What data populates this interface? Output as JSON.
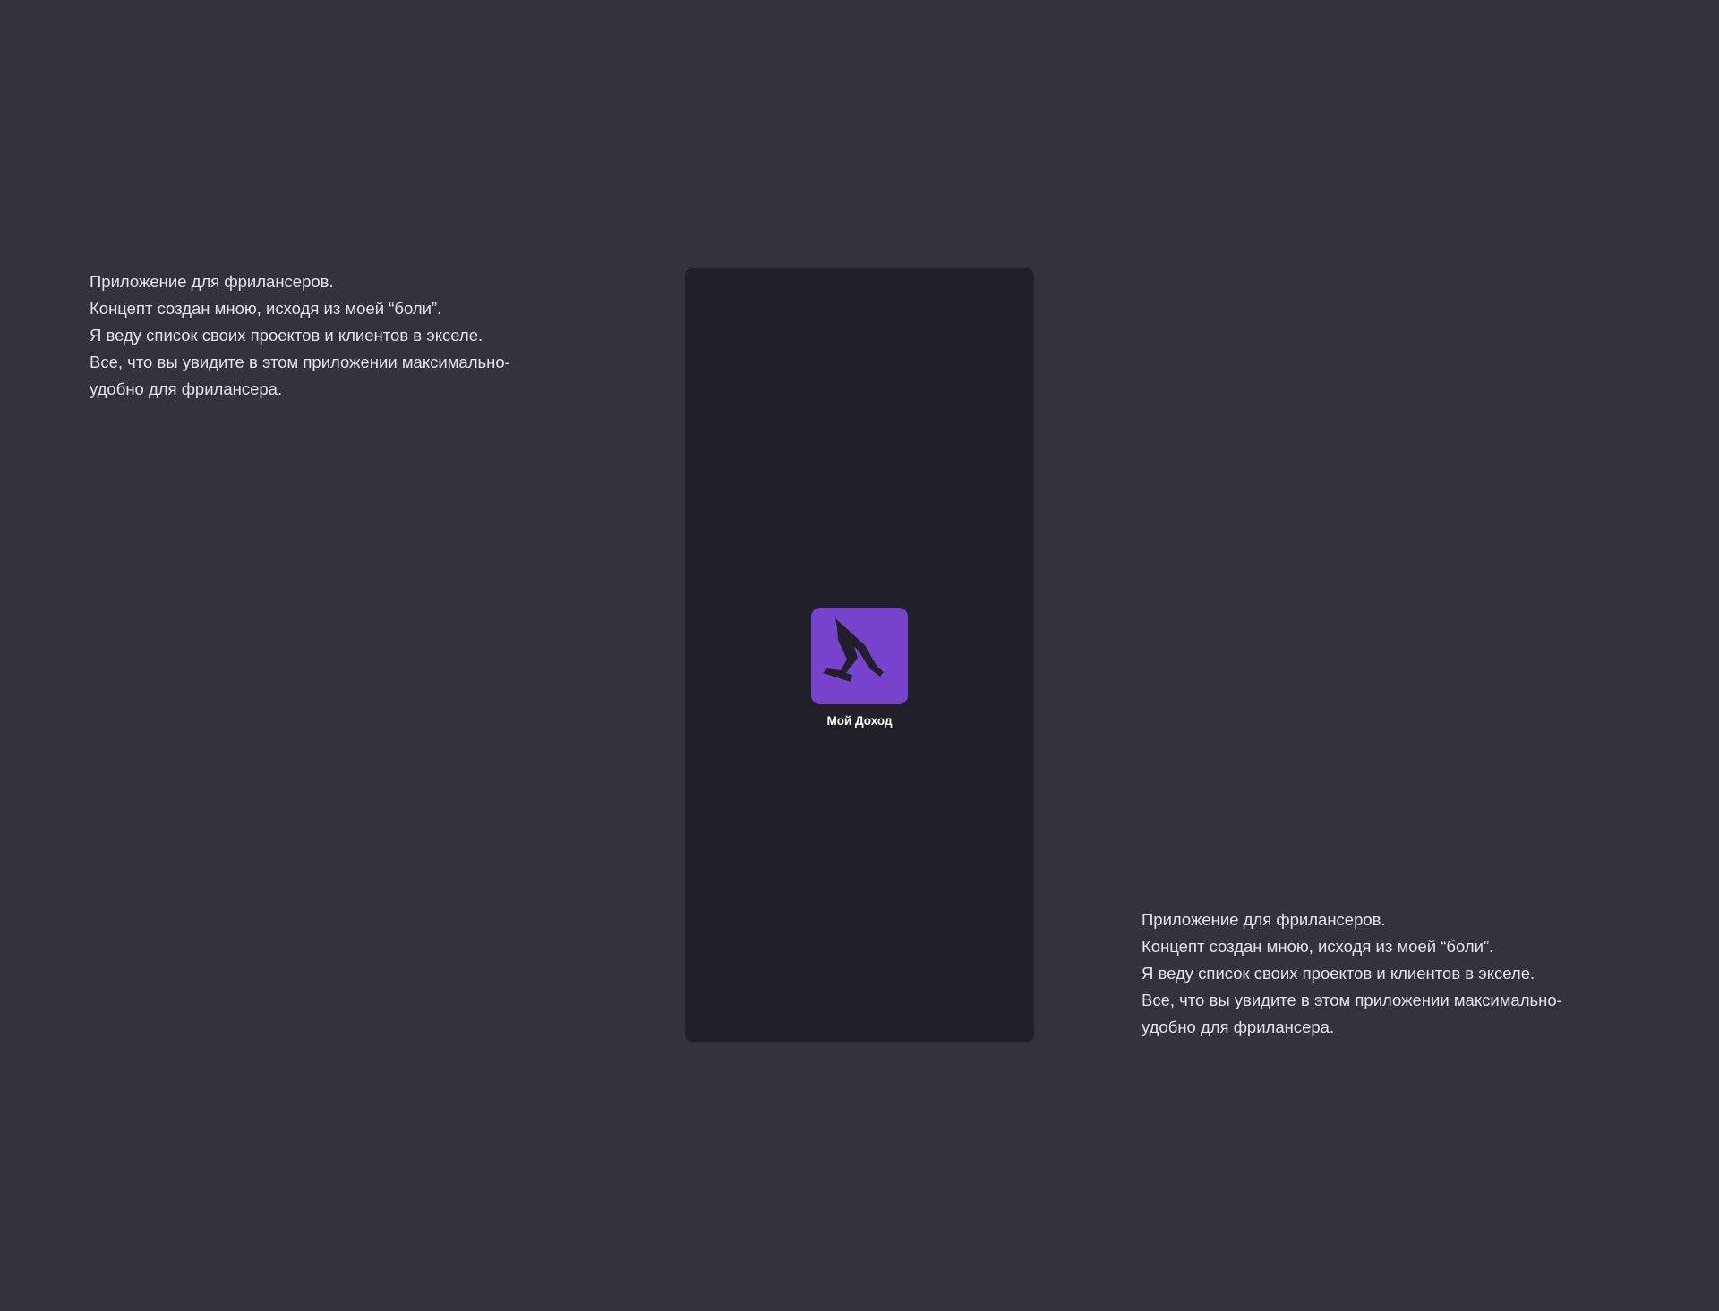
{
  "description": {
    "lines": [
      "Приложение для фрилансеров.",
      "Концепт создан мною, исходя из моей “боли”.",
      "Я веду список своих проектов и клиентов в экселе.",
      "Все, что вы увидите в этом приложении максимально-",
      "удобно для фрилансера."
    ]
  },
  "app": {
    "name": "Мой Доход",
    "icon": "running-figure-icon",
    "icon_color": "#7743cc"
  },
  "colors": {
    "background": "#34323d",
    "phone_screen": "#211f29",
    "text": "#e6e4ec"
  }
}
